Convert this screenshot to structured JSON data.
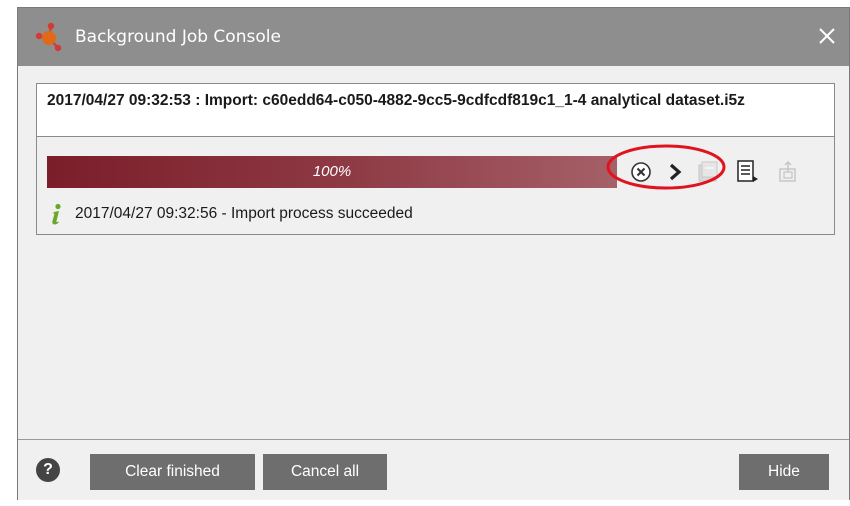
{
  "window": {
    "title": "Background Job Console",
    "close_icon": "close-icon"
  },
  "job": {
    "title": "2017/04/27 09:32:53 : Import: c60edd64-c050-4882-9cc5-9cdfcdf819c1_1-4 analytical dataset.i5z",
    "progress_value": 1.0,
    "progress_label": "100%",
    "actions": [
      "cancel-circle-icon",
      "chevron-right-icon",
      "console-window-icon",
      "log-file-icon",
      "export-icon"
    ],
    "status": {
      "icon": "info-icon",
      "text": "2017/04/27 09:32:56 - Import process succeeded"
    }
  },
  "footer": {
    "help_label": "?",
    "clear_finished_label": "Clear finished",
    "cancel_all_label": "Cancel all",
    "hide_label": "Hide"
  },
  "colors": {
    "titlebar": "#8e8e8e",
    "progress_fill": "#8d3843",
    "button": "#6e6e6e",
    "highlight": "#e0141e",
    "info_icon": "#6aa629"
  }
}
